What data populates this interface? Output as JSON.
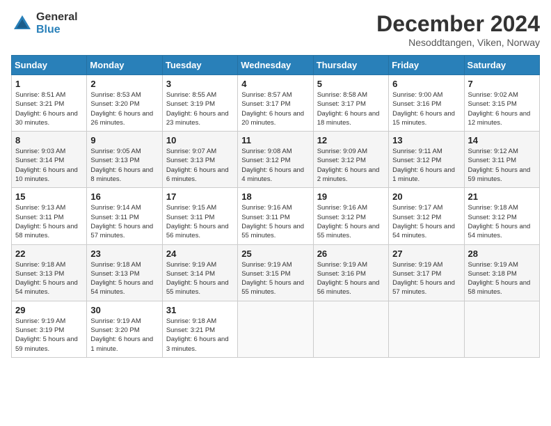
{
  "logo": {
    "general": "General",
    "blue": "Blue"
  },
  "header": {
    "title": "December 2024",
    "subtitle": "Nesoddtangen, Viken, Norway"
  },
  "weekdays": [
    "Sunday",
    "Monday",
    "Tuesday",
    "Wednesday",
    "Thursday",
    "Friday",
    "Saturday"
  ],
  "weeks": [
    [
      {
        "day": "1",
        "sunrise": "8:51 AM",
        "sunset": "3:21 PM",
        "daylight": "6 hours and 30 minutes."
      },
      {
        "day": "2",
        "sunrise": "8:53 AM",
        "sunset": "3:20 PM",
        "daylight": "6 hours and 26 minutes."
      },
      {
        "day": "3",
        "sunrise": "8:55 AM",
        "sunset": "3:19 PM",
        "daylight": "6 hours and 23 minutes."
      },
      {
        "day": "4",
        "sunrise": "8:57 AM",
        "sunset": "3:17 PM",
        "daylight": "6 hours and 20 minutes."
      },
      {
        "day": "5",
        "sunrise": "8:58 AM",
        "sunset": "3:17 PM",
        "daylight": "6 hours and 18 minutes."
      },
      {
        "day": "6",
        "sunrise": "9:00 AM",
        "sunset": "3:16 PM",
        "daylight": "6 hours and 15 minutes."
      },
      {
        "day": "7",
        "sunrise": "9:02 AM",
        "sunset": "3:15 PM",
        "daylight": "6 hours and 12 minutes."
      }
    ],
    [
      {
        "day": "8",
        "sunrise": "9:03 AM",
        "sunset": "3:14 PM",
        "daylight": "6 hours and 10 minutes."
      },
      {
        "day": "9",
        "sunrise": "9:05 AM",
        "sunset": "3:13 PM",
        "daylight": "6 hours and 8 minutes."
      },
      {
        "day": "10",
        "sunrise": "9:07 AM",
        "sunset": "3:13 PM",
        "daylight": "6 hours and 6 minutes."
      },
      {
        "day": "11",
        "sunrise": "9:08 AM",
        "sunset": "3:12 PM",
        "daylight": "6 hours and 4 minutes."
      },
      {
        "day": "12",
        "sunrise": "9:09 AM",
        "sunset": "3:12 PM",
        "daylight": "6 hours and 2 minutes."
      },
      {
        "day": "13",
        "sunrise": "9:11 AM",
        "sunset": "3:12 PM",
        "daylight": "6 hours and 1 minute."
      },
      {
        "day": "14",
        "sunrise": "9:12 AM",
        "sunset": "3:11 PM",
        "daylight": "5 hours and 59 minutes."
      }
    ],
    [
      {
        "day": "15",
        "sunrise": "9:13 AM",
        "sunset": "3:11 PM",
        "daylight": "5 hours and 58 minutes."
      },
      {
        "day": "16",
        "sunrise": "9:14 AM",
        "sunset": "3:11 PM",
        "daylight": "5 hours and 57 minutes."
      },
      {
        "day": "17",
        "sunrise": "9:15 AM",
        "sunset": "3:11 PM",
        "daylight": "5 hours and 56 minutes."
      },
      {
        "day": "18",
        "sunrise": "9:16 AM",
        "sunset": "3:11 PM",
        "daylight": "5 hours and 55 minutes."
      },
      {
        "day": "19",
        "sunrise": "9:16 AM",
        "sunset": "3:12 PM",
        "daylight": "5 hours and 55 minutes."
      },
      {
        "day": "20",
        "sunrise": "9:17 AM",
        "sunset": "3:12 PM",
        "daylight": "5 hours and 54 minutes."
      },
      {
        "day": "21",
        "sunrise": "9:18 AM",
        "sunset": "3:12 PM",
        "daylight": "5 hours and 54 minutes."
      }
    ],
    [
      {
        "day": "22",
        "sunrise": "9:18 AM",
        "sunset": "3:13 PM",
        "daylight": "5 hours and 54 minutes."
      },
      {
        "day": "23",
        "sunrise": "9:18 AM",
        "sunset": "3:13 PM",
        "daylight": "5 hours and 54 minutes."
      },
      {
        "day": "24",
        "sunrise": "9:19 AM",
        "sunset": "3:14 PM",
        "daylight": "5 hours and 55 minutes."
      },
      {
        "day": "25",
        "sunrise": "9:19 AM",
        "sunset": "3:15 PM",
        "daylight": "5 hours and 55 minutes."
      },
      {
        "day": "26",
        "sunrise": "9:19 AM",
        "sunset": "3:16 PM",
        "daylight": "5 hours and 56 minutes."
      },
      {
        "day": "27",
        "sunrise": "9:19 AM",
        "sunset": "3:17 PM",
        "daylight": "5 hours and 57 minutes."
      },
      {
        "day": "28",
        "sunrise": "9:19 AM",
        "sunset": "3:18 PM",
        "daylight": "5 hours and 58 minutes."
      }
    ],
    [
      {
        "day": "29",
        "sunrise": "9:19 AM",
        "sunset": "3:19 PM",
        "daylight": "5 hours and 59 minutes."
      },
      {
        "day": "30",
        "sunrise": "9:19 AM",
        "sunset": "3:20 PM",
        "daylight": "6 hours and 1 minute."
      },
      {
        "day": "31",
        "sunrise": "9:18 AM",
        "sunset": "3:21 PM",
        "daylight": "6 hours and 3 minutes."
      },
      null,
      null,
      null,
      null
    ]
  ]
}
